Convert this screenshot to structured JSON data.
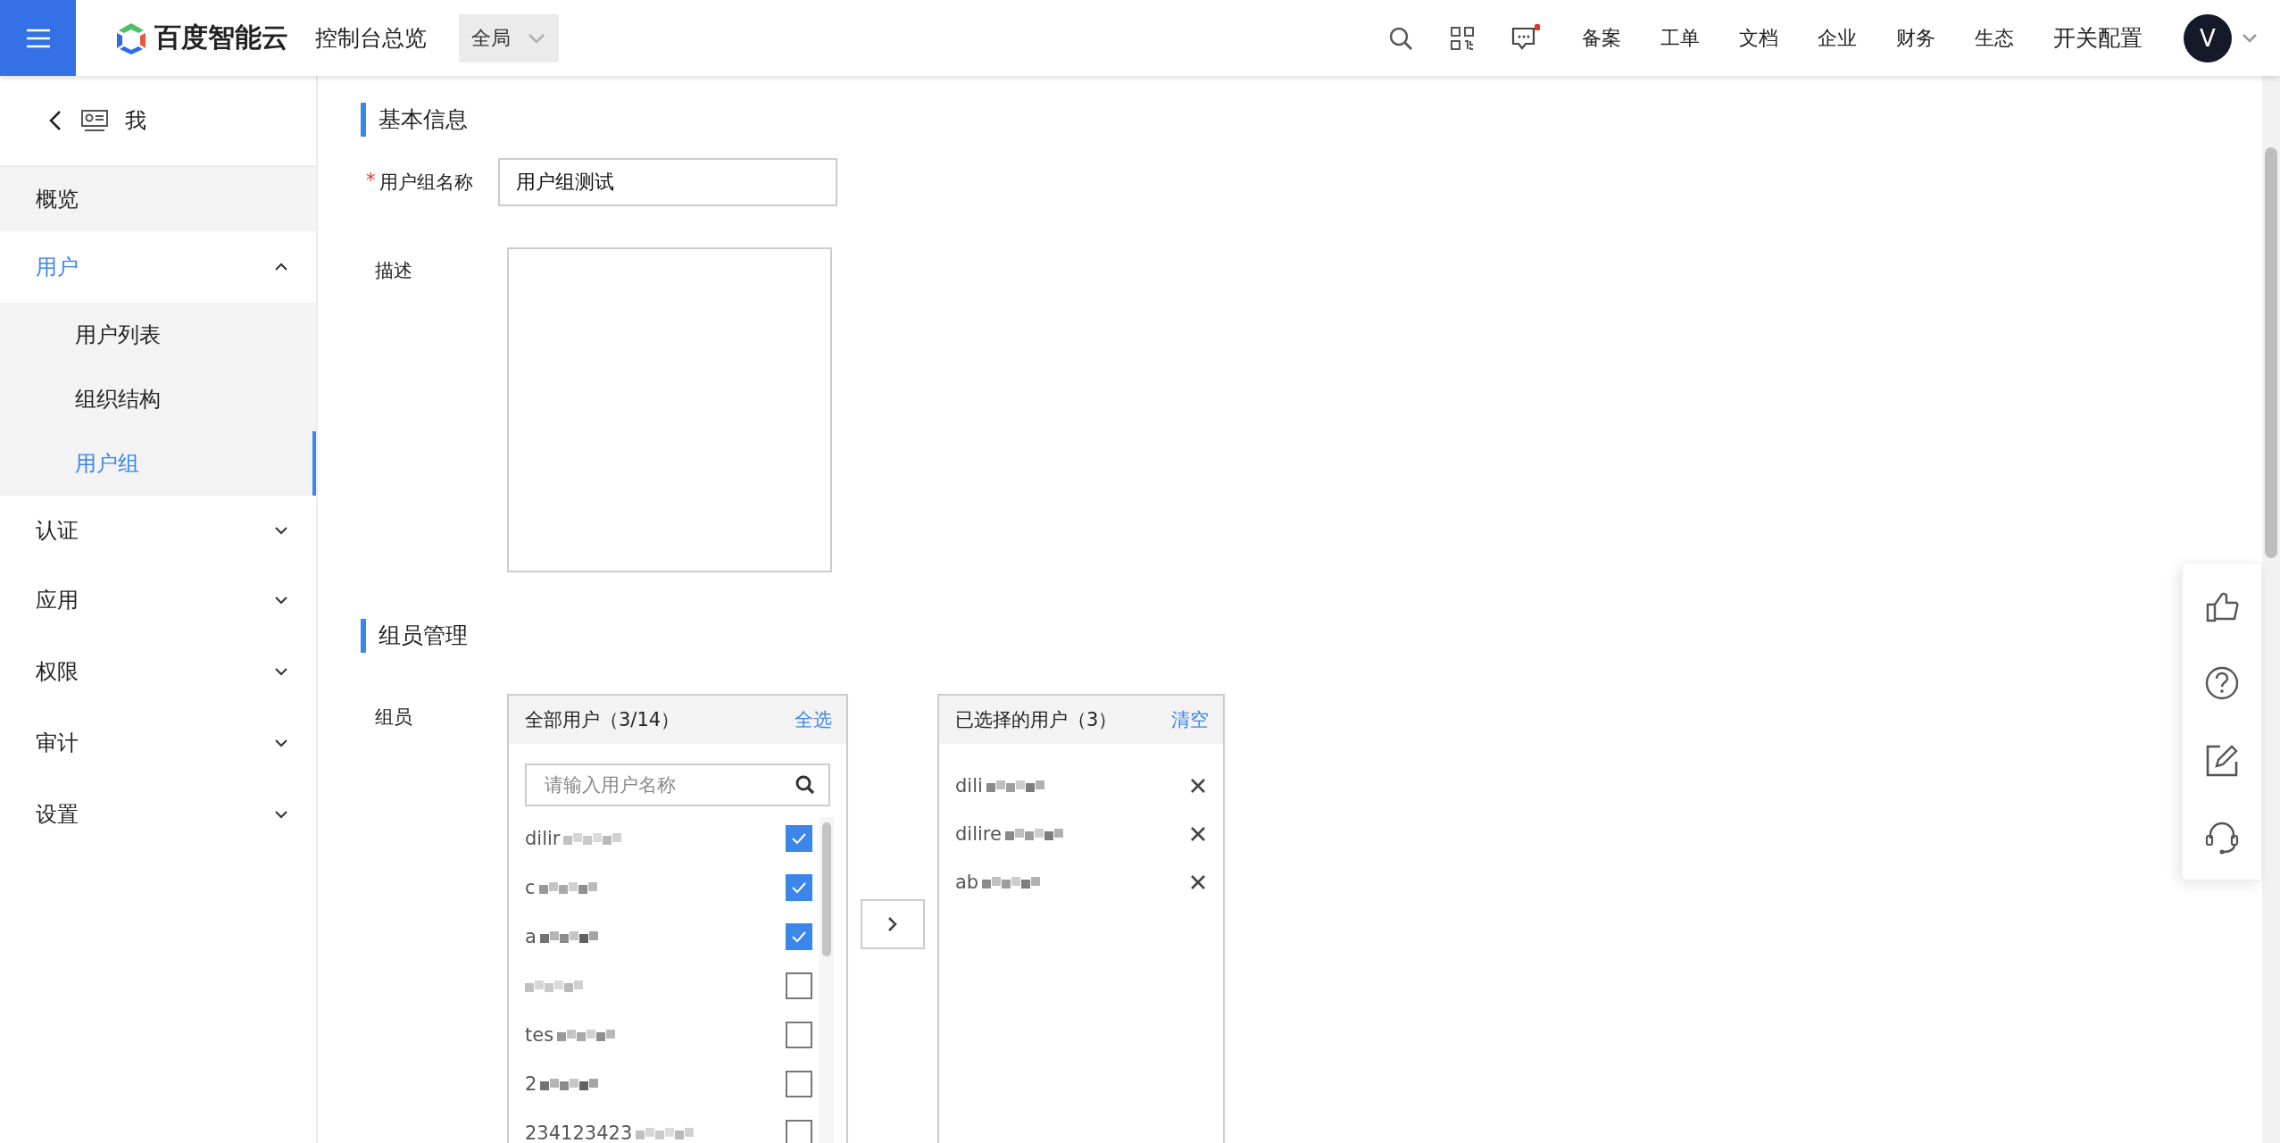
{
  "header": {
    "logo_text": "百度智能云",
    "console_title": "控制台总览",
    "region_select": "全局",
    "nav": [
      "备案",
      "工单",
      "文档",
      "企业",
      "财务",
      "生态",
      "开关配置"
    ],
    "message_unread": true,
    "avatar_letter": "V"
  },
  "sidebar": {
    "title": "我",
    "items": [
      {
        "label": "概览",
        "selected": false
      },
      {
        "label": "用户",
        "selected": true,
        "expanded": true,
        "children": [
          {
            "label": "用户列表",
            "selected": false
          },
          {
            "label": "组织结构",
            "selected": false
          },
          {
            "label": "用户组",
            "selected": true
          }
        ]
      },
      {
        "label": "认证",
        "selected": false,
        "expanded": false
      },
      {
        "label": "应用",
        "selected": false,
        "expanded": false
      },
      {
        "label": "权限",
        "selected": false,
        "expanded": false
      },
      {
        "label": "审计",
        "selected": false,
        "expanded": false
      },
      {
        "label": "设置",
        "selected": false,
        "expanded": false
      }
    ]
  },
  "basic_info": {
    "title": "基本信息",
    "name_label": "用户组名称",
    "name_required_mark": "*",
    "name_value": "用户组测试",
    "description_label": "描述"
  },
  "members": {
    "title": "组员管理",
    "label": "组员",
    "all_users": {
      "title": "全部用户（3/14）",
      "select_all": "全选",
      "search_placeholder": "请输入用户名称",
      "items": [
        {
          "name": "dilir",
          "checked": true
        },
        {
          "name": "c",
          "checked": true
        },
        {
          "name": "a",
          "checked": true
        },
        {
          "checked": false
        },
        {
          "name": "tes",
          "checked": false
        },
        {
          "name": "2",
          "checked": false
        },
        {
          "name": "234123423",
          "checked": false
        }
      ]
    },
    "selected_users": {
      "title": "已选择的用户（3）",
      "clear": "清空",
      "items": [
        {
          "name": "dili"
        },
        {
          "name": "dilire"
        },
        {
          "name": "ab"
        }
      ]
    }
  }
}
